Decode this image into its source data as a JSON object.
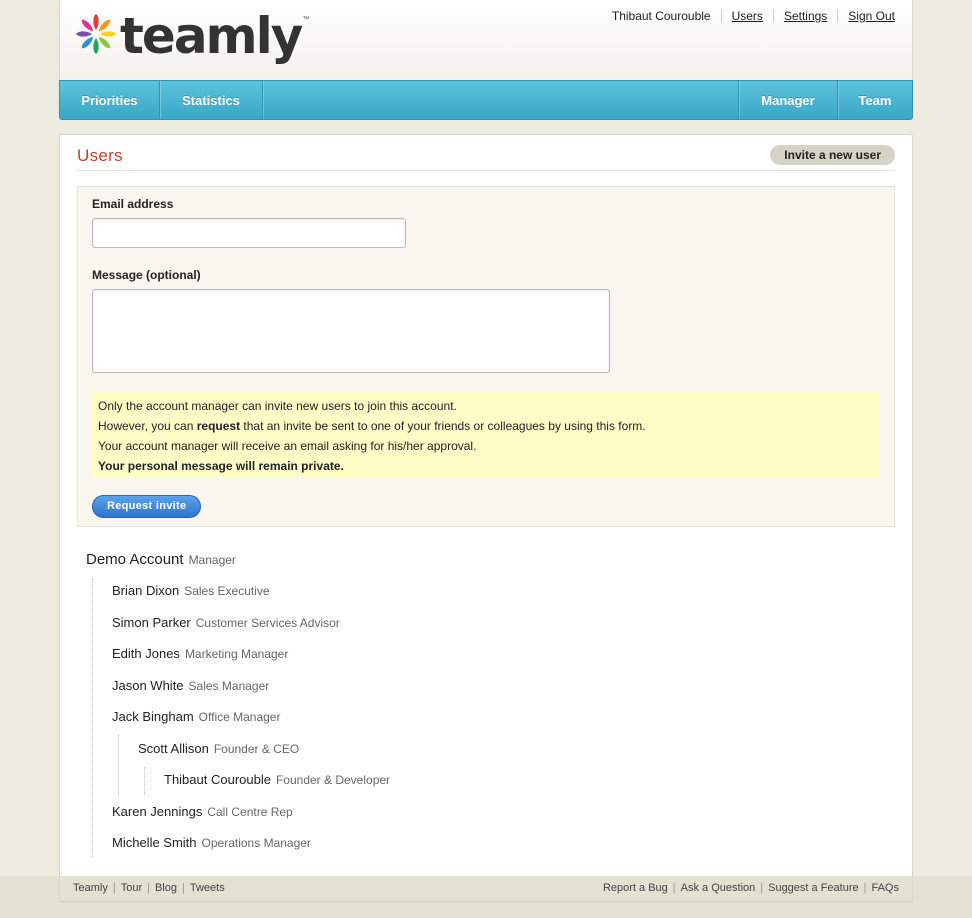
{
  "brand": {
    "name": "teamly",
    "tm": "™"
  },
  "user_nav": {
    "username": "Thibaut Courouble",
    "links": [
      "Users",
      "Settings",
      "Sign Out"
    ]
  },
  "main_nav": {
    "left": [
      "Priorities",
      "Statistics"
    ],
    "right": [
      "Manager",
      "Team"
    ]
  },
  "page": {
    "title": "Users",
    "invite_button": "Invite a new user"
  },
  "invite_form": {
    "email_label": "Email address",
    "email_value": "",
    "message_label": "Message (optional)",
    "message_value": "",
    "notice": {
      "line1": "Only the account manager can invite new users to join this account.",
      "line2_pre": "However, you can ",
      "line2_bold": "request",
      "line2_post": " that an invite be sent to one of your friends or colleagues by using this form.",
      "line3": "Your account manager will receive an email asking for his/her approval.",
      "line4": "Your personal message will remain private."
    },
    "submit_label": "Request invite"
  },
  "user_tree": {
    "root": {
      "name": "Demo Account",
      "role": "Manager"
    },
    "members": [
      {
        "name": "Brian Dixon",
        "role": "Sales Executive",
        "level": 1
      },
      {
        "name": "Simon Parker",
        "role": "Customer Services Advisor",
        "level": 1
      },
      {
        "name": "Edith Jones",
        "role": "Marketing Manager",
        "level": 1
      },
      {
        "name": "Jason White",
        "role": "Sales Manager",
        "level": 1
      },
      {
        "name": "Jack Bingham",
        "role": "Office Manager",
        "level": 1
      },
      {
        "name": "Scott Allison",
        "role": "Founder & CEO",
        "level": 2
      },
      {
        "name": "Thibaut Courouble",
        "role": "Founder & Developer",
        "level": 3
      },
      {
        "name": "Karen Jennings",
        "role": "Call Centre Rep",
        "level": 1
      },
      {
        "name": "Michelle Smith",
        "role": "Operations Manager",
        "level": 1
      }
    ]
  },
  "footer": {
    "left": [
      "Teamly",
      "Tour",
      "Blog",
      "Tweets"
    ],
    "right": [
      "Report a Bug",
      "Ask a Question",
      "Suggest a Feature",
      "FAQs"
    ]
  },
  "colors": {
    "accent_title": "#c1432c",
    "nav_blue": "#3aa7c6",
    "button_blue": "#2b74cf",
    "notice_yellow": "#fffdc6"
  }
}
